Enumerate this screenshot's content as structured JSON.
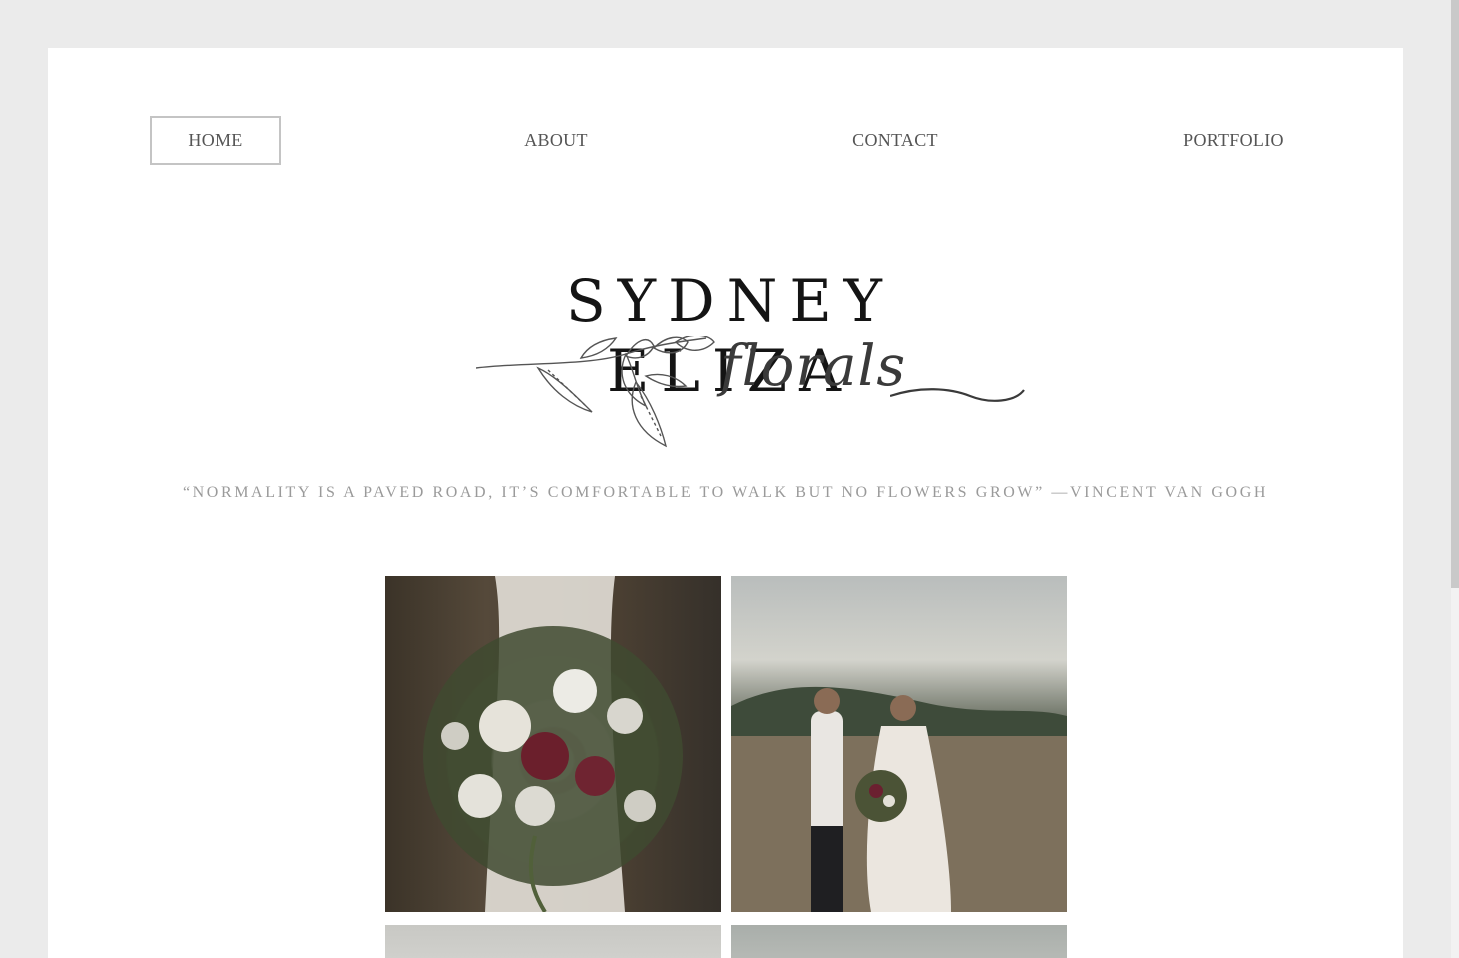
{
  "nav": {
    "home": "HOME",
    "about": "ABOUT",
    "contact": "CONTACT",
    "portfolio": "PORTFOLIO"
  },
  "logo": {
    "title": "SYDNEY ELIZA",
    "script": "florals"
  },
  "quote": "“NORMALITY IS A PAVED ROAD, IT’S COMFORTABLE TO WALK BUT NO FLOWERS GROW” —VINCENT VAN GOGH",
  "gallery": [
    {
      "name": "bouquet-photo"
    },
    {
      "name": "couple-field-photo"
    },
    {
      "name": "photo-3"
    },
    {
      "name": "photo-4"
    }
  ],
  "colors": {
    "background": "#ebebeb",
    "page": "#ffffff",
    "nav_text": "#555555",
    "quote_text": "#9a9a9a",
    "logo_text": "#141414"
  }
}
